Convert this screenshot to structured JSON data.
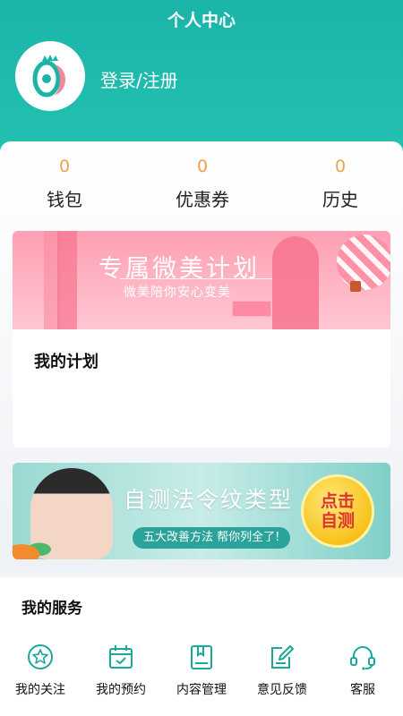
{
  "header": {
    "title": "个人中心",
    "login_text": "登录/注册"
  },
  "stats": [
    {
      "count": "0",
      "label": "钱包"
    },
    {
      "count": "0",
      "label": "优惠券"
    },
    {
      "count": "0",
      "label": "历史"
    }
  ],
  "banner_plan": {
    "title": "专属微美计划",
    "subtitle": "微美陪你安心变美"
  },
  "plan_card": {
    "title": "我的计划"
  },
  "banner_test": {
    "title": "自测法令纹类型",
    "subtitle": "五大改善方法 帮你列全了!",
    "badge": "点击自测"
  },
  "services": {
    "title": "我的服务",
    "items": [
      {
        "label": "我的关注",
        "icon": "star-circle-icon"
      },
      {
        "label": "我的预约",
        "icon": "calendar-icon"
      },
      {
        "label": "内容管理",
        "icon": "book-icon"
      },
      {
        "label": "意见反馈",
        "icon": "edit-icon"
      },
      {
        "label": "客服",
        "icon": "headset-icon"
      }
    ]
  },
  "colors": {
    "brand": "#1ab5a8",
    "stat_number": "#f0a04b",
    "icon": "#1aa89c"
  }
}
